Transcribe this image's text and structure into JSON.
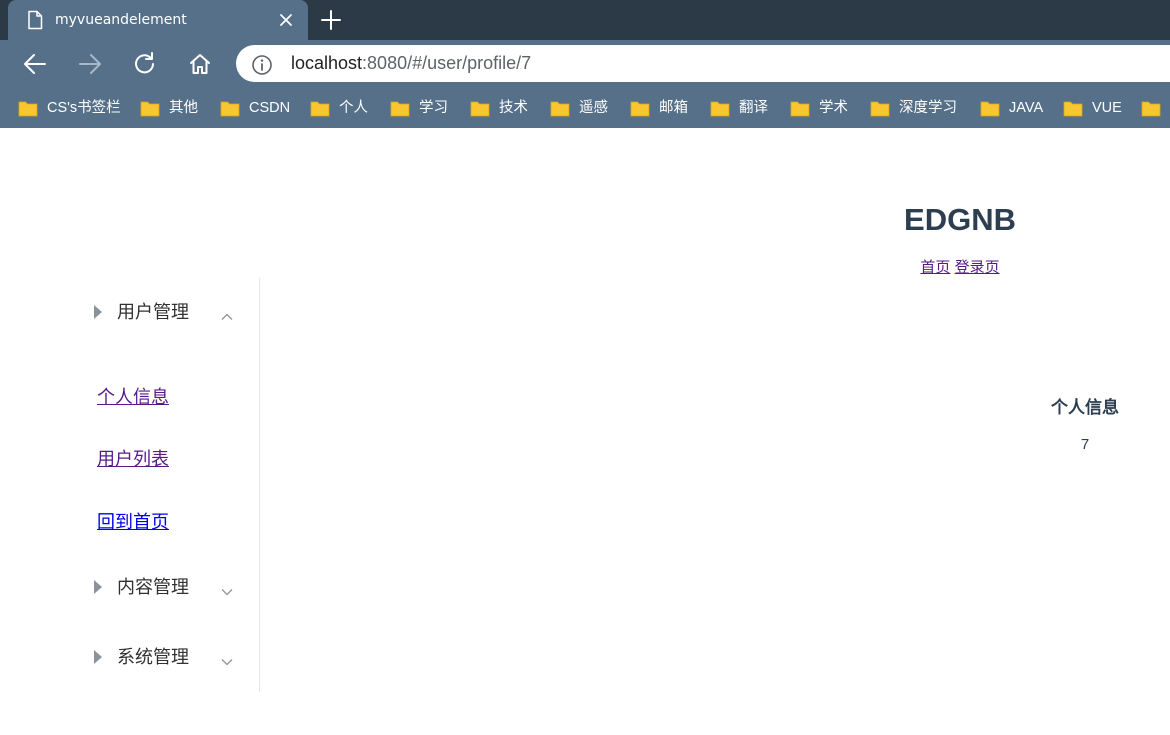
{
  "browser": {
    "tab_title": "myvueandelement",
    "url_host": "localhost",
    "url_rest": ":8080/#/user/profile/7",
    "bookmarks": [
      "CS's书签栏",
      "其他",
      "CSDN",
      "个人",
      "学习",
      "技术",
      "遥感",
      "邮箱",
      "翻译",
      "学术",
      "深度学习",
      "JAVA",
      "VUE"
    ]
  },
  "header": {
    "title": "EDGNB",
    "links": {
      "home": "首页",
      "login": "登录页"
    }
  },
  "sidebar": {
    "groups": [
      {
        "label": "用户管理",
        "expanded": true,
        "items": [
          "个人信息",
          "用户列表",
          "回到首页"
        ]
      },
      {
        "label": "内容管理",
        "expanded": false
      },
      {
        "label": "系统管理",
        "expanded": false
      }
    ]
  },
  "main": {
    "heading": "个人信息",
    "user_id": "7"
  },
  "colors": {
    "chrome_dark": "#2c3a47",
    "chrome": "#56708a",
    "folder": "#f8c631",
    "title": "#2c3e50",
    "visited_link": "#551a8b",
    "link": "#0000ee"
  }
}
